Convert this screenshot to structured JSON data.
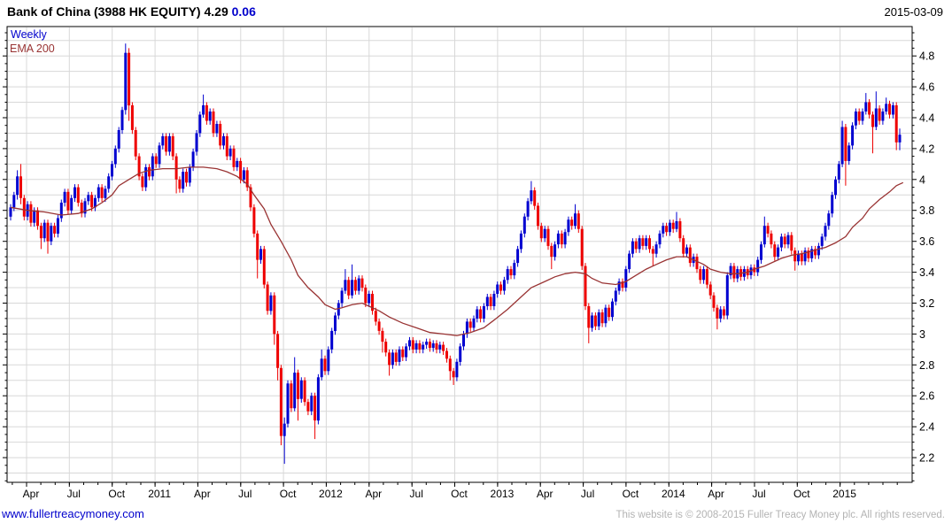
{
  "header": {
    "title_main": "Bank of China (3988 HK EQUITY) 4.29",
    "change": "0.06",
    "date": "2015-03-09"
  },
  "legend": {
    "series": "Weekly",
    "overlay": "EMA 200"
  },
  "footer": {
    "link": "www.fullertreacymoney.com",
    "copyright": "This website is © 2008-2015 Fuller Treacy Money plc. All rights reserved."
  },
  "colors": {
    "up": "#0000d0",
    "down": "#ee0000",
    "ema": "#993333",
    "grid": "#d8d8d8",
    "axis": "#000000",
    "text": "#000000",
    "accent_change": "#0000cc",
    "link": "#0000cc",
    "copyright": "#b3b3b3"
  },
  "chart_data": {
    "type": "candlestick",
    "title": "Bank of China (3988 HK EQUITY)",
    "interval": "Weekly",
    "overlay": "EMA 200",
    "last_price": 4.29,
    "change": 0.06,
    "date": "2015-03-09",
    "ylim": [
      2.04,
      4.99
    ],
    "y_gridline_step": 0.1,
    "y_tick_labels": [
      "4.8",
      "4.6",
      "4.4",
      "4.2",
      "4",
      "3.8",
      "3.6",
      "3.4",
      "3.2",
      "3",
      "2.8",
      "2.6",
      "2.4",
      "2.2"
    ],
    "x_labels": [
      "Apr",
      "Jul",
      "Oct",
      "2011",
      "Apr",
      "Jul",
      "Oct",
      "2012",
      "Apr",
      "Jul",
      "Oct",
      "2013",
      "Apr",
      "Jul",
      "Oct",
      "2014",
      "Apr",
      "Jul",
      "Oct",
      "2015"
    ],
    "first_open": 3.76,
    "closes": [
      3.82,
      3.9,
      4.02,
      3.88,
      3.76,
      3.84,
      3.72,
      3.8,
      3.7,
      3.62,
      3.72,
      3.6,
      3.7,
      3.65,
      3.75,
      3.85,
      3.92,
      3.8,
      3.88,
      3.95,
      3.85,
      3.78,
      3.86,
      3.9,
      3.82,
      3.88,
      3.95,
      3.88,
      3.94,
      4.02,
      4.1,
      4.2,
      4.32,
      4.45,
      4.82,
      4.48,
      4.32,
      4.15,
      4.02,
      3.95,
      4.08,
      4.02,
      4.15,
      4.1,
      4.22,
      4.28,
      4.18,
      4.28,
      4.15,
      4.0,
      3.94,
      4.05,
      3.98,
      4.08,
      4.18,
      4.3,
      4.42,
      4.48,
      4.38,
      4.44,
      4.3,
      4.36,
      4.22,
      4.28,
      4.15,
      4.2,
      4.08,
      4.12,
      4.0,
      4.06,
      3.95,
      3.82,
      3.65,
      3.48,
      3.55,
      3.32,
      3.15,
      3.25,
      3.0,
      2.78,
      2.34,
      2.42,
      2.68,
      2.52,
      2.75,
      2.58,
      2.7,
      2.56,
      2.5,
      2.6,
      2.44,
      2.72,
      2.84,
      2.76,
      2.9,
      3.02,
      3.12,
      3.2,
      3.28,
      3.35,
      3.25,
      3.35,
      3.28,
      3.36,
      3.3,
      3.2,
      3.26,
      3.15,
      3.08,
      3.02,
      2.95,
      2.88,
      2.8,
      2.88,
      2.82,
      2.9,
      2.85,
      2.92,
      2.96,
      2.9,
      2.94,
      2.9,
      2.93,
      2.95,
      2.91,
      2.94,
      2.9,
      2.93,
      2.89,
      2.84,
      2.76,
      2.72,
      2.82,
      2.92,
      3.0,
      3.08,
      3.04,
      3.1,
      3.16,
      3.1,
      3.18,
      3.24,
      3.18,
      3.26,
      3.32,
      3.28,
      3.35,
      3.42,
      3.38,
      3.46,
      3.55,
      3.65,
      3.76,
      3.86,
      3.93,
      3.83,
      3.7,
      3.62,
      3.68,
      3.57,
      3.5,
      3.58,
      3.65,
      3.58,
      3.66,
      3.74,
      3.7,
      3.78,
      3.68,
      3.44,
      3.18,
      3.04,
      3.12,
      3.05,
      3.14,
      3.07,
      3.17,
      3.11,
      3.21,
      3.28,
      3.34,
      3.3,
      3.42,
      3.52,
      3.6,
      3.55,
      3.62,
      3.57,
      3.62,
      3.55,
      3.52,
      3.58,
      3.65,
      3.7,
      3.66,
      3.72,
      3.68,
      3.73,
      3.62,
      3.52,
      3.56,
      3.46,
      3.5,
      3.42,
      3.35,
      3.42,
      3.32,
      3.25,
      3.17,
      3.1,
      3.16,
      3.12,
      3.38,
      3.44,
      3.36,
      3.42,
      3.37,
      3.42,
      3.38,
      3.43,
      3.4,
      3.48,
      3.58,
      3.7,
      3.65,
      3.58,
      3.5,
      3.56,
      3.63,
      3.58,
      3.64,
      3.54,
      3.47,
      3.52,
      3.47,
      3.54,
      3.49,
      3.55,
      3.51,
      3.57,
      3.63,
      3.7,
      3.78,
      3.9,
      4.0,
      4.1,
      4.34,
      4.12,
      4.22,
      4.35,
      4.44,
      4.38,
      4.44,
      4.5,
      4.42,
      4.34,
      4.46,
      4.38,
      4.44,
      4.49,
      4.42,
      4.48,
      4.24,
      4.29
    ],
    "wicks": {
      "2": [
        4.06,
        3.87
      ],
      "3": [
        4.1,
        3.84
      ],
      "9": [
        3.72,
        3.55
      ],
      "11": [
        3.74,
        3.52
      ],
      "34": [
        4.88,
        4.42
      ],
      "35": [
        4.85,
        4.38
      ],
      "49": [
        4.17,
        3.91
      ],
      "57": [
        4.55,
        4.4
      ],
      "73": [
        3.67,
        3.36
      ],
      "78": [
        3.27,
        2.93
      ],
      "79": [
        3.02,
        2.7
      ],
      "80": [
        2.8,
        2.28
      ],
      "81": [
        2.46,
        2.16
      ],
      "84": [
        2.85,
        2.5
      ],
      "85": [
        2.77,
        2.44
      ],
      "90": [
        2.62,
        2.32
      ],
      "92": [
        2.9,
        2.7
      ],
      "99": [
        3.42,
        3.26
      ],
      "101": [
        3.45,
        3.23
      ],
      "110": [
        3.04,
        2.88
      ],
      "112": [
        2.9,
        2.73
      ],
      "130": [
        2.86,
        2.7
      ],
      "131": [
        2.78,
        2.67
      ],
      "154": [
        3.99,
        3.84
      ],
      "160": [
        3.59,
        3.42
      ],
      "167": [
        3.84,
        3.68
      ],
      "171": [
        3.2,
        2.94
      ],
      "190": [
        3.57,
        3.44
      ],
      "197": [
        3.79,
        3.66
      ],
      "209": [
        3.19,
        3.03
      ],
      "223": [
        3.76,
        3.56
      ],
      "232": [
        3.56,
        3.41
      ],
      "246": [
        4.38,
        4.08
      ],
      "247": [
        4.36,
        3.96
      ],
      "253": [
        4.56,
        4.42
      ],
      "255": [
        4.44,
        4.17
      ],
      "256": [
        4.57,
        4.32
      ],
      "259": [
        4.53,
        4.42
      ],
      "262": [
        4.5,
        4.19
      ],
      "263": [
        4.33,
        4.19
      ]
    },
    "ema": [
      [
        0,
        3.82
      ],
      [
        5,
        3.8
      ],
      [
        10,
        3.79
      ],
      [
        15,
        3.77
      ],
      [
        20,
        3.78
      ],
      [
        24,
        3.81
      ],
      [
        27,
        3.85
      ],
      [
        30,
        3.9
      ],
      [
        32,
        3.96
      ],
      [
        35,
        4.0
      ],
      [
        38,
        4.04
      ],
      [
        41,
        4.06
      ],
      [
        45,
        4.07
      ],
      [
        49,
        4.07
      ],
      [
        53,
        4.08
      ],
      [
        57,
        4.08
      ],
      [
        61,
        4.07
      ],
      [
        64,
        4.05
      ],
      [
        67,
        4.02
      ],
      [
        70,
        3.97
      ],
      [
        72,
        3.9
      ],
      [
        75,
        3.81
      ],
      [
        77,
        3.71
      ],
      [
        80,
        3.6
      ],
      [
        83,
        3.48
      ],
      [
        85,
        3.38
      ],
      [
        88,
        3.3
      ],
      [
        91,
        3.24
      ],
      [
        93,
        3.19
      ],
      [
        96,
        3.16
      ],
      [
        98,
        3.17
      ],
      [
        101,
        3.19
      ],
      [
        104,
        3.2
      ],
      [
        106,
        3.18
      ],
      [
        109,
        3.15
      ],
      [
        112,
        3.11
      ],
      [
        116,
        3.07
      ],
      [
        120,
        3.04
      ],
      [
        124,
        3.01
      ],
      [
        128,
        3.0
      ],
      [
        132,
        2.99
      ],
      [
        136,
        3.01
      ],
      [
        140,
        3.04
      ],
      [
        143,
        3.09
      ],
      [
        147,
        3.16
      ],
      [
        151,
        3.24
      ],
      [
        154,
        3.3
      ],
      [
        158,
        3.34
      ],
      [
        161,
        3.37
      ],
      [
        164,
        3.39
      ],
      [
        167,
        3.4
      ],
      [
        170,
        3.39
      ],
      [
        172,
        3.36
      ],
      [
        175,
        3.33
      ],
      [
        179,
        3.32
      ],
      [
        182,
        3.34
      ],
      [
        185,
        3.38
      ],
      [
        188,
        3.42
      ],
      [
        191,
        3.45
      ],
      [
        194,
        3.48
      ],
      [
        197,
        3.5
      ],
      [
        200,
        3.5
      ],
      [
        202,
        3.48
      ],
      [
        205,
        3.45
      ],
      [
        207,
        3.42
      ],
      [
        210,
        3.4
      ],
      [
        213,
        3.39
      ],
      [
        215,
        3.39
      ],
      [
        218,
        3.4
      ],
      [
        220,
        3.42
      ],
      [
        223,
        3.44
      ],
      [
        226,
        3.47
      ],
      [
        228,
        3.49
      ],
      [
        231,
        3.51
      ],
      [
        234,
        3.52
      ],
      [
        236,
        3.53
      ],
      [
        239,
        3.55
      ],
      [
        241,
        3.56
      ],
      [
        244,
        3.59
      ],
      [
        247,
        3.63
      ],
      [
        249,
        3.69
      ],
      [
        252,
        3.75
      ],
      [
        254,
        3.81
      ],
      [
        257,
        3.87
      ],
      [
        260,
        3.92
      ],
      [
        262,
        3.96
      ],
      [
        264,
        3.98
      ]
    ]
  }
}
